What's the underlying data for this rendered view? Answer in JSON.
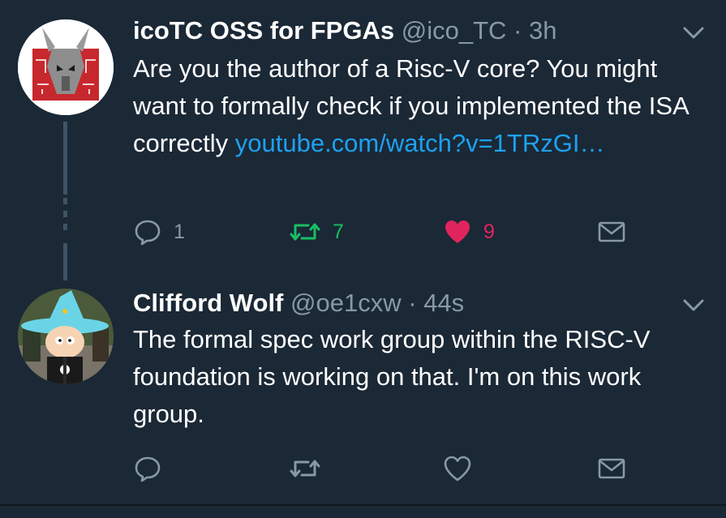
{
  "colors": {
    "background": "#1b2836",
    "text": "#ffffff",
    "muted": "#8899a6",
    "link": "#1da1f2",
    "retweet_active": "#17bf63",
    "like_active": "#e0245e"
  },
  "tweets": [
    {
      "name": "icoTC OSS for FPGAs",
      "handle": "@ico_TC",
      "separator": "·",
      "time": "3h",
      "text": "Are you the author of a Risc-V core? You might want to formally check if you implemented the ISA correctly ",
      "link": "youtube.com/watch?v=1TRzGI…",
      "reply_count": "1",
      "retweet_count": "7",
      "like_count": "9",
      "liked": true,
      "retweeted": true,
      "avatar_icon": "circuit-goat-logo-avatar",
      "icons": {
        "reply": "reply-icon",
        "retweet": "retweet-icon",
        "like": "heart-icon",
        "dm": "envelope-icon",
        "menu": "chevron-down-icon"
      }
    },
    {
      "name": "Clifford Wolf",
      "handle": "@oe1cxw",
      "separator": "·",
      "time": "44s",
      "text": "The formal spec work group within the RISC-V foundation is working on that. I'm on this work group.",
      "reply_count": "",
      "retweet_count": "",
      "like_count": "",
      "liked": false,
      "retweeted": false,
      "avatar_icon": "wizard-cartoon-avatar",
      "icons": {
        "reply": "reply-icon",
        "retweet": "retweet-icon",
        "like": "heart-icon",
        "dm": "envelope-icon",
        "menu": "chevron-down-icon"
      }
    }
  ]
}
